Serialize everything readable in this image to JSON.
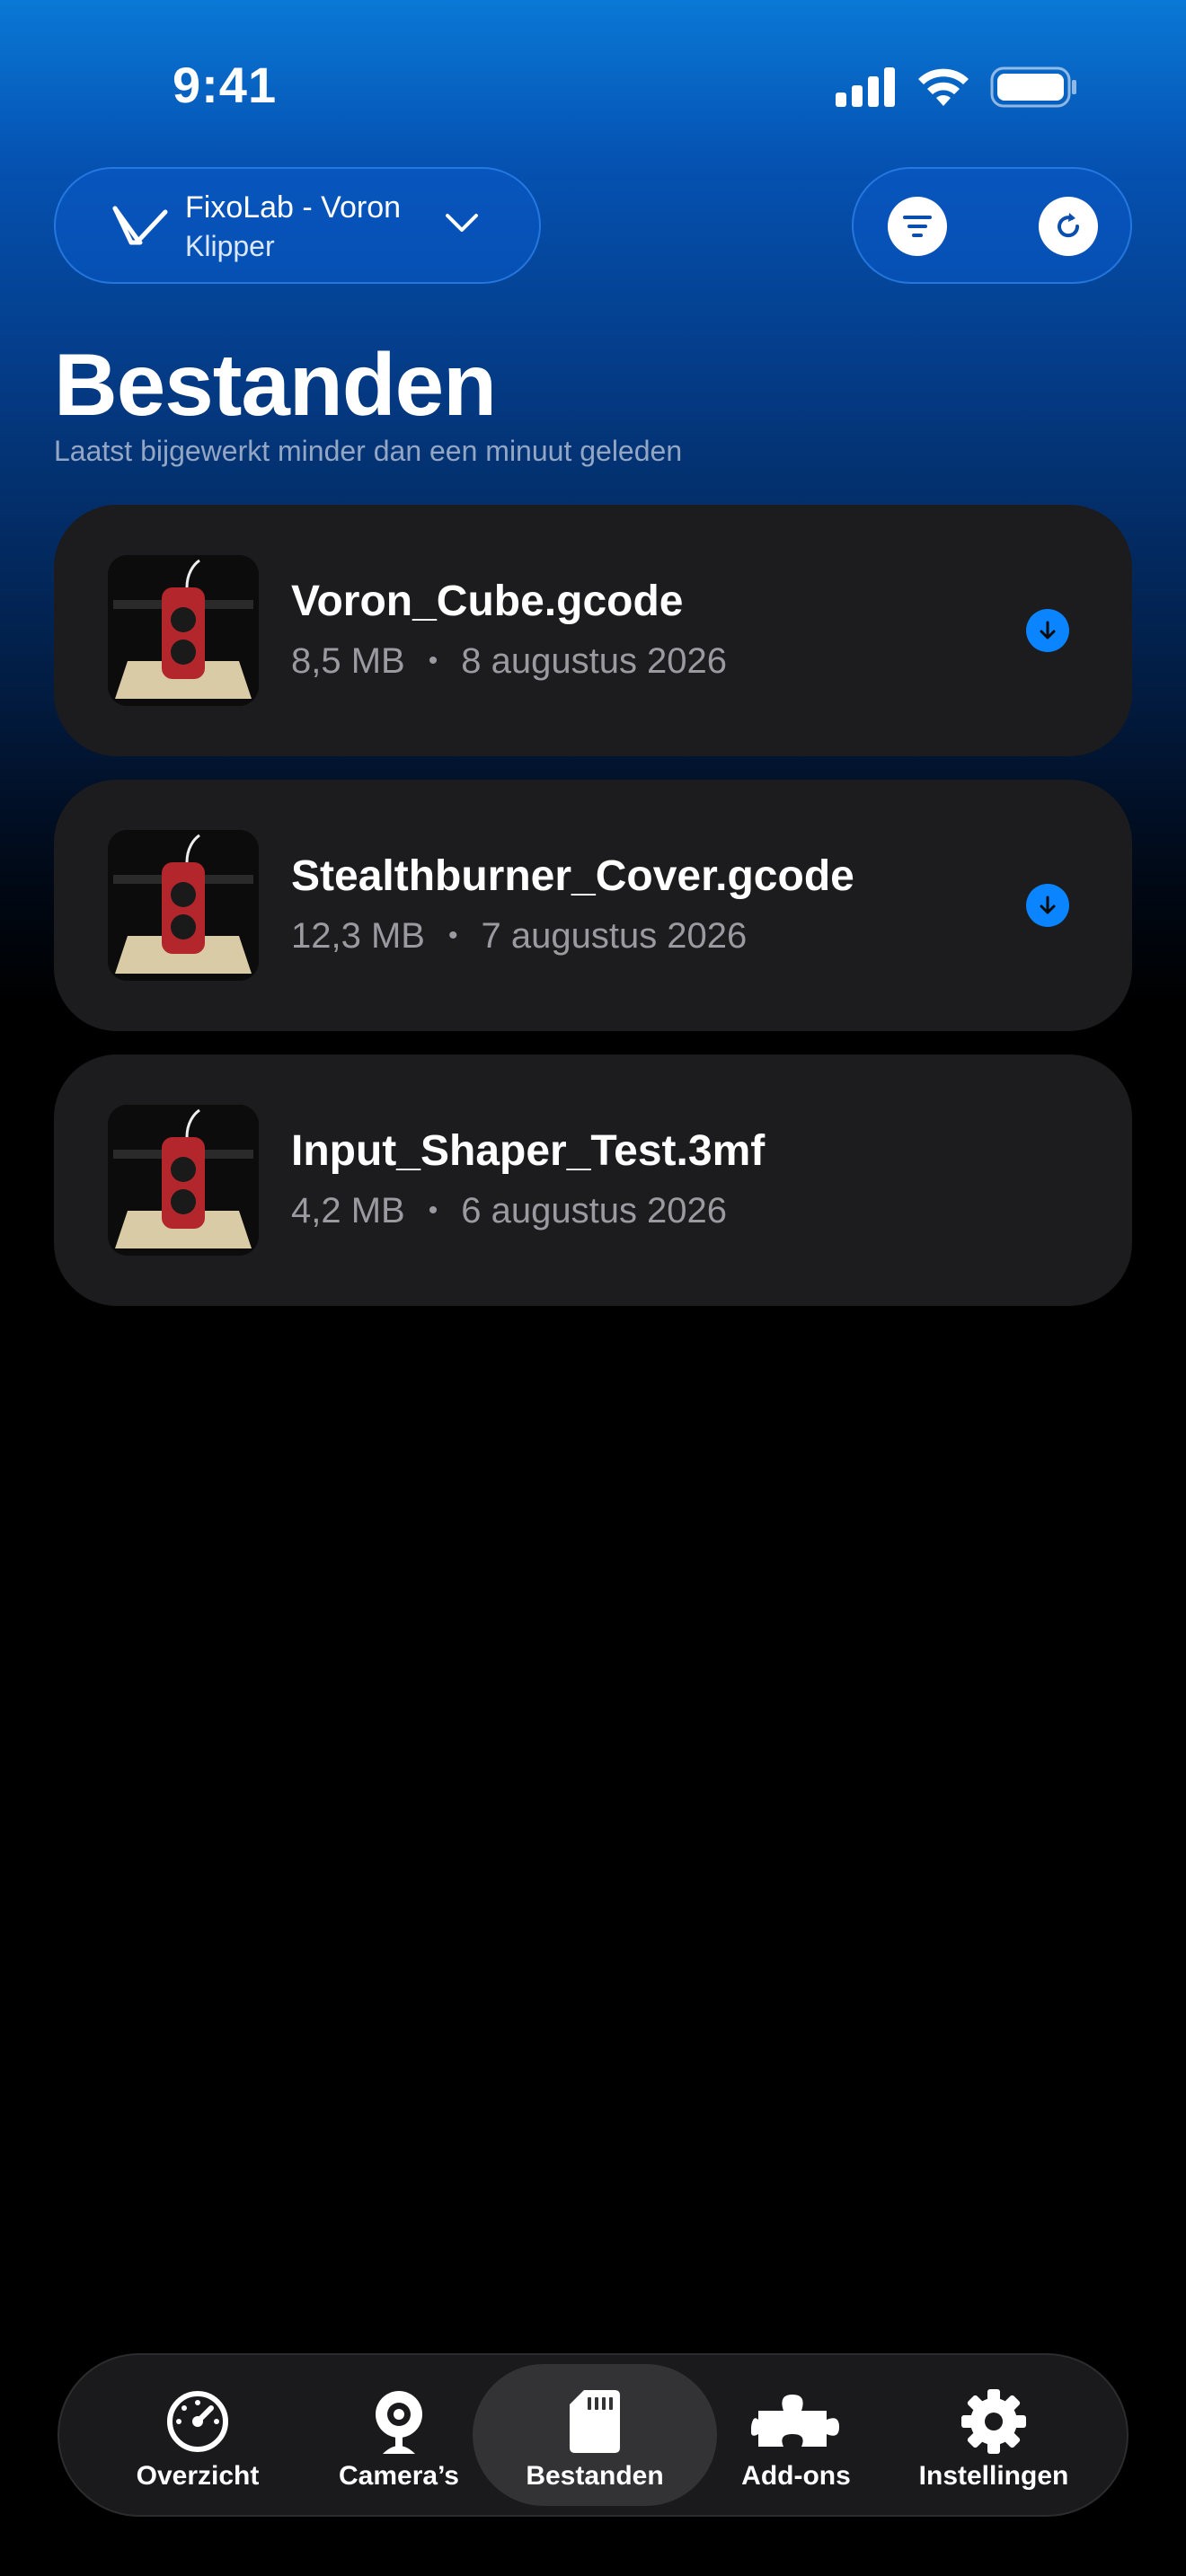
{
  "status_bar": {
    "time": "9:41"
  },
  "printer_selector": {
    "name": "FixoLab - Voron",
    "firmware": "Klipper"
  },
  "page": {
    "title": "Bestanden",
    "subtitle": "Laatst bijgewerkt minder dan een minuut geleden"
  },
  "files": [
    {
      "name": "Voron_Cube.gcode",
      "size": "8,5 MB",
      "date": "8 augustus 2026",
      "downloadable": true
    },
    {
      "name": "Stealthburner_Cover.gcode",
      "size": "12,3 MB",
      "date": "7 augustus 2026",
      "downloadable": true
    },
    {
      "name": "Input_Shaper_Test.3mf",
      "size": "4,2 MB",
      "date": "6 augustus 2026",
      "downloadable": false
    }
  ],
  "meta_separator": "•",
  "tabs": [
    {
      "label": "Overzicht",
      "icon": "speedometer-icon",
      "active": false
    },
    {
      "label": "Camera’s",
      "icon": "webcam-icon",
      "active": false
    },
    {
      "label": "Bestanden",
      "icon": "sd-card-icon",
      "active": true
    },
    {
      "label": "Add-ons",
      "icon": "puzzle-icon",
      "active": false
    },
    {
      "label": "Instellingen",
      "icon": "gear-icon",
      "active": false
    }
  ],
  "colors": {
    "accent": "#0a84ff",
    "card": "#1c1c1e",
    "gradient_top": "#0a78d6",
    "background": "#000000"
  }
}
